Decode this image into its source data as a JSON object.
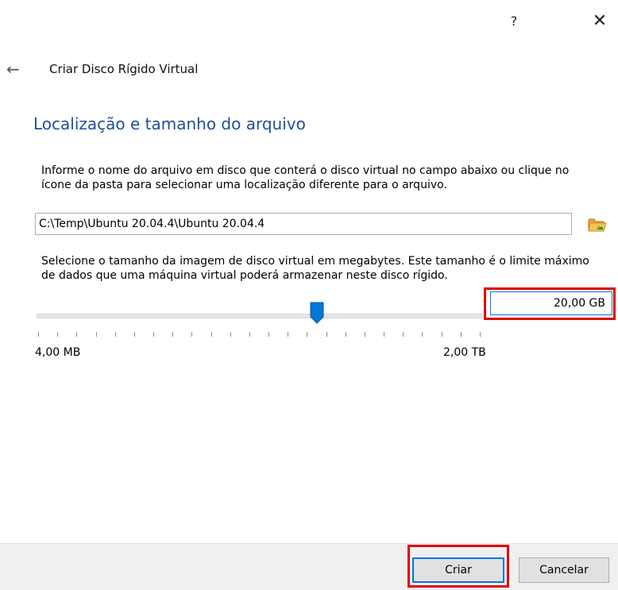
{
  "titlebar": {
    "help_glyph": "?",
    "close_glyph": "✕"
  },
  "header": {
    "back_glyph": "←",
    "title": "Criar Disco Rígido Virtual"
  },
  "page": {
    "heading": "Localização e tamanho do arquivo",
    "file_instructions": "Informe o nome do arquivo em disco que conterá o disco virtual no campo abaixo ou clique no ícone da pasta para selecionar uma localização diferente para o arquivo.",
    "file_path": "C:\\Temp\\Ubuntu 20.04.4\\Ubuntu 20.04.4",
    "size_instructions": "Selecione o tamanho da imagem de disco virtual em megabytes. Este tamanho é o limite máximo de dados que uma máquina virtual poderá armazenar neste disco rígido.",
    "slider": {
      "min_label": "4,00 MB",
      "max_label": "2,00 TB",
      "position_fraction": 0.63
    },
    "size_value": "20,00 GB"
  },
  "footer": {
    "create_label": "Criar",
    "cancel_label": "Cancelar"
  },
  "colors": {
    "heading": "#1f4f9a",
    "accent": "#0078d7",
    "highlight": "#e10000"
  },
  "icons": {
    "folder": "folder-open-icon",
    "back": "back-arrow-icon",
    "help": "help-icon",
    "close": "close-icon"
  }
}
